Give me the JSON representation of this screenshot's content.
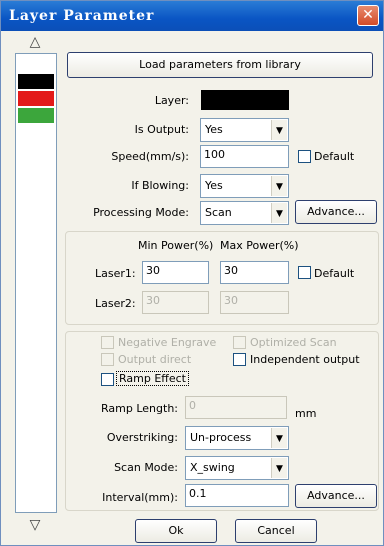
{
  "window": {
    "title": "Layer Parameter",
    "close_glyph": "✕"
  },
  "layer_list": {
    "up_arrow": "△",
    "down_arrow": "▽",
    "colors": [
      "#000000",
      "#e31a1a",
      "#3ca63c"
    ]
  },
  "load_button": "Load parameters from library",
  "layer": {
    "label": "Layer:",
    "color": "#000000"
  },
  "is_output": {
    "label": "Is Output:",
    "value": "Yes"
  },
  "speed": {
    "label": "Speed(mm/s):",
    "value": "100",
    "default_label": "Default"
  },
  "if_blowing": {
    "label": "If Blowing:",
    "value": "Yes"
  },
  "processing_mode": {
    "label": "Processing Mode:",
    "value": "Scan",
    "advance_label": "Advance..."
  },
  "power": {
    "min_header": "Min Power(%)",
    "max_header": "Max Power(%)",
    "laser1_label": "Laser1:",
    "laser1_min": "30",
    "laser1_max": "30",
    "default_label": "Default",
    "laser2_label": "Laser2:",
    "laser2_min": "30",
    "laser2_max": "30"
  },
  "options": {
    "negative_engrave": "Negative Engrave",
    "optimized_scan": "Optimized Scan",
    "output_direct": "Output direct",
    "independent_output": "Independent output",
    "ramp_effect": "Ramp Effect"
  },
  "ramp_length": {
    "label": "Ramp Length:",
    "value": "0",
    "unit": "mm"
  },
  "overstriking": {
    "label": "Overstriking:",
    "value": "Un-process"
  },
  "scan_mode": {
    "label": "Scan Mode:",
    "value": "X_swing"
  },
  "interval": {
    "label": "Interval(mm):",
    "value": "0.1",
    "advance_label": "Advance..."
  },
  "footer": {
    "ok": "Ok",
    "cancel": "Cancel"
  }
}
